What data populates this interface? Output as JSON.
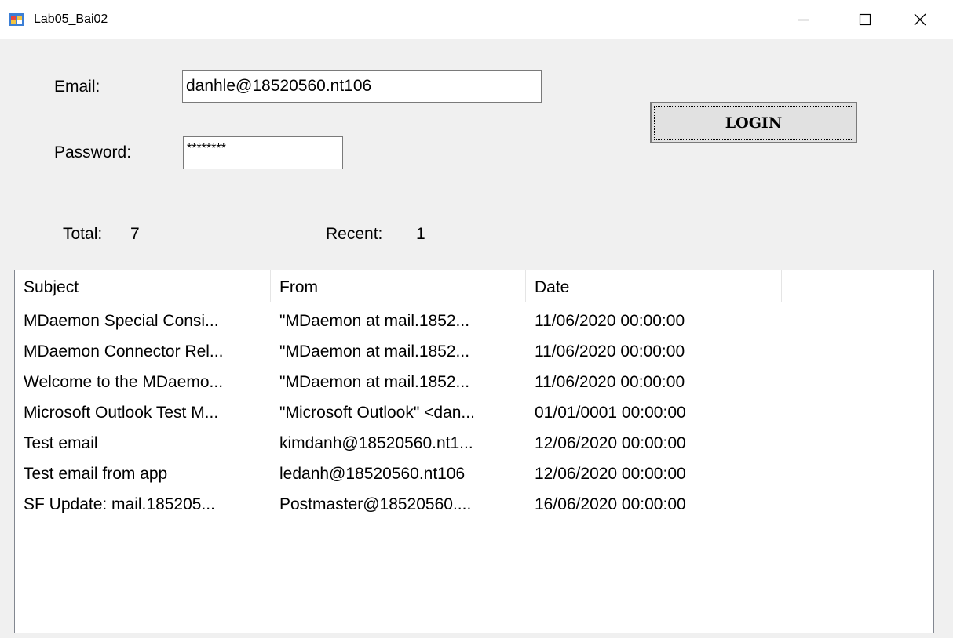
{
  "window": {
    "title": "Lab05_Bai02"
  },
  "form": {
    "email_label": "Email:",
    "email_value": "danhle@18520560.nt106",
    "password_label": "Password:",
    "password_value": "********",
    "login_label": "LOGIN",
    "total_label": "Total:",
    "total_value": "7",
    "recent_label": "Recent:",
    "recent_value": "1"
  },
  "list": {
    "columns": [
      "Subject",
      "From",
      "Date"
    ],
    "rows": [
      [
        "MDaemon Special Consi...",
        "\"MDaemon at mail.1852...",
        "11/06/2020 00:00:00"
      ],
      [
        "MDaemon Connector Rel...",
        "\"MDaemon at mail.1852...",
        "11/06/2020 00:00:00"
      ],
      [
        "Welcome to the MDaemo...",
        "\"MDaemon at mail.1852...",
        "11/06/2020 00:00:00"
      ],
      [
        "Microsoft Outlook Test M...",
        "\"Microsoft Outlook\" <dan...",
        "01/01/0001 00:00:00"
      ],
      [
        "Test email",
        "kimdanh@18520560.nt1...",
        "12/06/2020 00:00:00"
      ],
      [
        "Test email from app",
        "ledanh@18520560.nt106",
        "12/06/2020 00:00:00"
      ],
      [
        "SF Update: mail.185205...",
        "Postmaster@18520560....",
        "16/06/2020 00:00:00"
      ]
    ]
  },
  "icons": {
    "app": "app-window-icon",
    "minimize": "minimize-icon",
    "maximize": "maximize-icon",
    "close": "close-icon"
  }
}
